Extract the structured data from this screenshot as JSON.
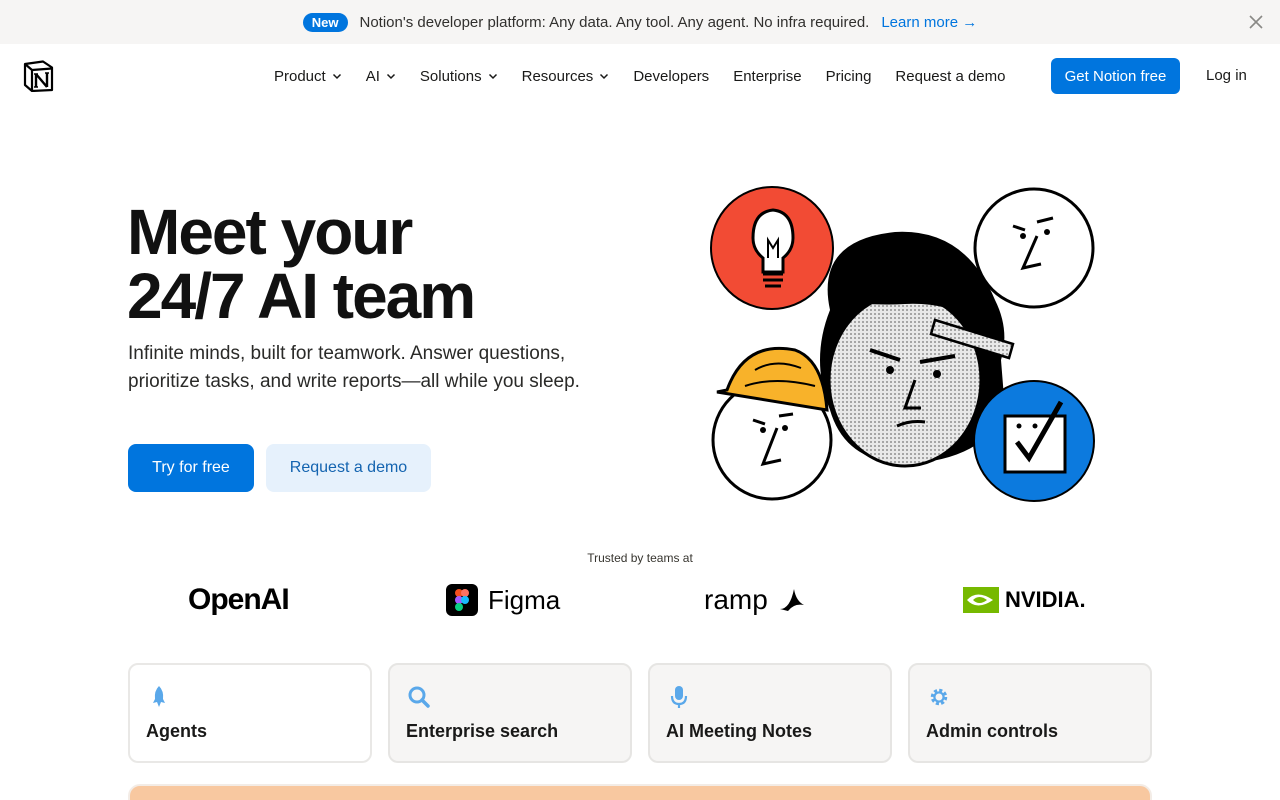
{
  "banner": {
    "badge": "New",
    "text": "Notion's developer platform: Any data. Any tool. Any agent. No infra required.",
    "link": "Learn more →"
  },
  "nav": {
    "items": [
      {
        "label": "Product",
        "dropdown": true
      },
      {
        "label": "AI",
        "dropdown": true
      },
      {
        "label": "Solutions",
        "dropdown": true
      },
      {
        "label": "Resources",
        "dropdown": true
      },
      {
        "label": "Developers",
        "dropdown": false
      },
      {
        "label": "Enterprise",
        "dropdown": false
      },
      {
        "label": "Pricing",
        "dropdown": false
      },
      {
        "label": "Request a demo",
        "dropdown": false
      }
    ],
    "cta": "Get Notion free",
    "login": "Log in"
  },
  "hero": {
    "title_line1": "Meet your",
    "title_line2": "24/7 AI team",
    "subtitle": "Infinite minds, built for teamwork. Answer questions, prioritize tasks, and write reports—all while you sleep.",
    "primary_button": "Try for free",
    "secondary_button": "Request a demo"
  },
  "trusted": {
    "label": "Trusted by teams at",
    "brands": [
      "OpenAI",
      "Figma",
      "ramp",
      "NVIDIA."
    ]
  },
  "cards": [
    {
      "label": "Agents",
      "icon": "rocket-icon",
      "active": true
    },
    {
      "label": "Enterprise search",
      "icon": "search-icon",
      "active": false
    },
    {
      "label": "AI Meeting Notes",
      "icon": "microphone-icon",
      "active": false
    },
    {
      "label": "Admin controls",
      "icon": "gear-icon",
      "active": false
    }
  ],
  "colors": {
    "accent": "#0075de",
    "accent_light": "#e6f1fc",
    "banner_bg": "#f6f5f4",
    "icon_blue": "#5aa8ea",
    "illus_red": "#f24b34",
    "illus_yellow": "#f8b22a",
    "illus_blue": "#0c7ade",
    "nvidia_green": "#76b900"
  }
}
